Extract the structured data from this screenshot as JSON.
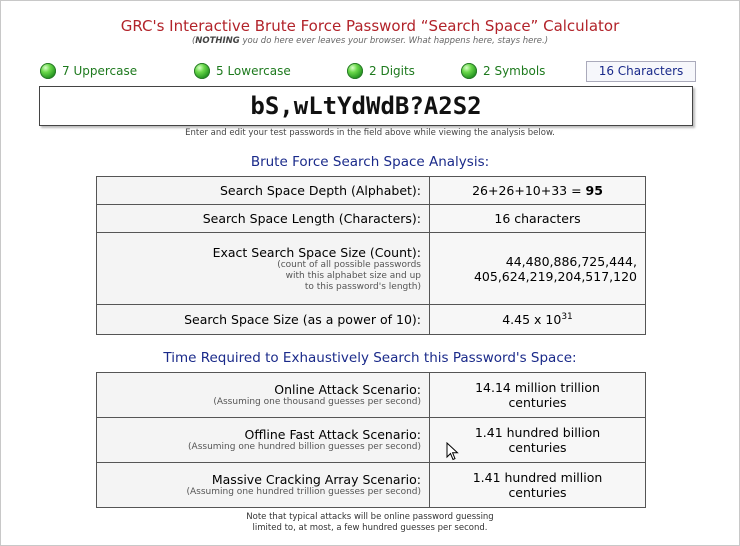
{
  "header": {
    "title": "GRC's Interactive Brute Force Password “Search Space” Calculator",
    "subtitle_bold": "NOTHING",
    "subtitle_rest": " you do here ever leaves your browser. What happens here, stays here.)",
    "subtitle_open": "("
  },
  "indicators": [
    {
      "label": "7 Uppercase"
    },
    {
      "label": "5 Lowercase"
    },
    {
      "label": "2 Digits"
    },
    {
      "label": "2 Symbols"
    }
  ],
  "length_label": "16 Characters",
  "password": {
    "value": "bS,wLtYdWdB?A2S2",
    "hint": "Enter and edit your test passwords in the field above while viewing the analysis below."
  },
  "analysis": {
    "heading": "Brute Force Search Space Analysis:",
    "depth_label": "Search Space Depth (Alphabet):",
    "depth_value_prefix": "26+26+10+33 = ",
    "depth_value_bold": "95",
    "length_label": "Search Space Length (Characters):",
    "length_value": "16 characters",
    "exact_label": "Exact Search Space Size (Count):",
    "exact_note_1": "(count of all possible passwords",
    "exact_note_2": "with this alphabet size and up",
    "exact_note_3": "to this password's length)",
    "exact_value_1": "44,480,886,725,444,",
    "exact_value_2": "405,624,219,204,517,120",
    "power_label": "Search Space Size (as a power of 10):",
    "power_value_base": "4.45 x 10",
    "power_value_exp": "31"
  },
  "time": {
    "heading": "Time Required to Exhaustively Search this Password's Space:",
    "online_label": "Online Attack Scenario:",
    "online_note": "(Assuming one thousand guesses per second)",
    "online_value_1": "14.14 million trillion",
    "online_value_2": "centuries",
    "offline_label": "Offline Fast Attack Scenario:",
    "offline_note": "(Assuming one hundred billion guesses per second)",
    "offline_value_1": "1.41 hundred billion",
    "offline_value_2": "centuries",
    "massive_label": "Massive Cracking Array Scenario:",
    "massive_note": "(Assuming one hundred trillion guesses per second)",
    "massive_value_1": "1.41 hundred million",
    "massive_value_2": "centuries"
  },
  "footnote": {
    "line1": "Note that typical attacks will be online password guessing",
    "line2": "limited to, at most, a few hundred guesses per second."
  },
  "colors": {
    "title": "#b2232a",
    "heading": "#1a2a8a",
    "indicator_text": "#1e7a1e",
    "led_green": "#1c8c1c"
  }
}
